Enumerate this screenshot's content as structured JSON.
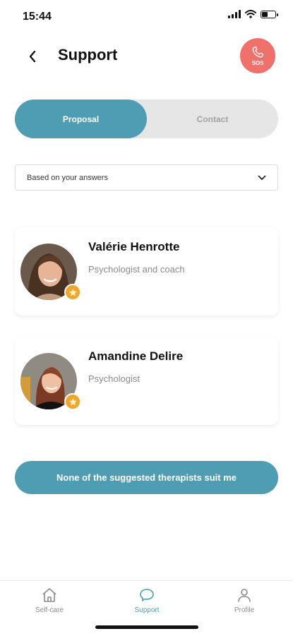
{
  "status_bar": {
    "time": "15:44",
    "icons": [
      "signal-icon",
      "wifi-icon",
      "battery-icon"
    ]
  },
  "header": {
    "title": "Support",
    "back_icon": "chevron-left-icon",
    "sos_label": "SOS",
    "sos_icon": "phone-icon"
  },
  "tabs_segment": {
    "active": "Proposal",
    "inactive": "Contact"
  },
  "filter": {
    "selected": "Based on your answers",
    "icon": "chevron-down-icon"
  },
  "therapists": [
    {
      "name": "Valérie Henrotte",
      "role": "Psychologist and coach",
      "badge_icon": "star-icon"
    },
    {
      "name": "Amandine Delire",
      "role": "Psychologist",
      "badge_icon": "star-icon"
    }
  ],
  "none_button_label": "None of the suggested therapists suit me",
  "bottom_nav": [
    {
      "label": "Self-care",
      "icon": "home-icon",
      "active": false
    },
    {
      "label": "Support",
      "icon": "chat-bubble-icon",
      "active": true
    },
    {
      "label": "Profile",
      "icon": "user-icon",
      "active": false
    }
  ],
  "colors": {
    "accent": "#4f9db3",
    "sos": "#f0706b",
    "star": "#f0a62c",
    "inactive_tab": "#a2a2a2"
  }
}
